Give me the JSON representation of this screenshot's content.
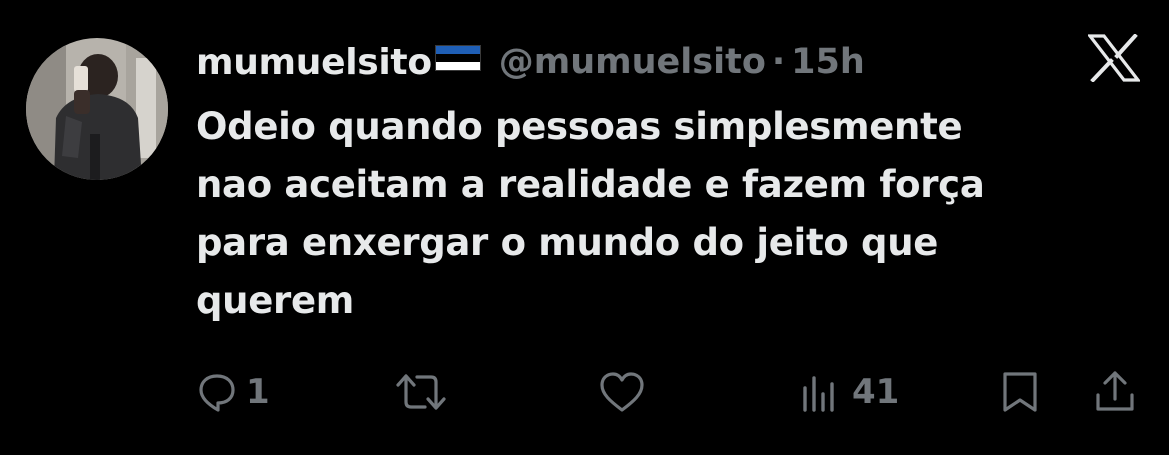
{
  "tweet": {
    "display_name": "mumuelsito",
    "flag_icon": "estonia-flag-icon",
    "flag_colors": [
      "#1f5fb6",
      "#000000",
      "#ffffff"
    ],
    "handle": "@mumuelsito",
    "separator": "·",
    "time": "15h",
    "brand_icon": "x-logo-icon",
    "text": "Odeio quando pessoas simplesmente\nnao aceitam a realidade e fazem força\npara enxergar o mundo do jeito que\nquerem"
  },
  "actions": {
    "reply": {
      "icon": "reply-icon",
      "count": "1"
    },
    "repost": {
      "icon": "repost-icon"
    },
    "like": {
      "icon": "heart-icon"
    },
    "views": {
      "icon": "views-icon",
      "count": "41"
    },
    "bookmark": {
      "icon": "bookmark-icon"
    },
    "share": {
      "icon": "share-icon"
    }
  },
  "colors": {
    "background": "#000000",
    "primary_text": "#e7e9ea",
    "secondary_text": "#71767b"
  }
}
